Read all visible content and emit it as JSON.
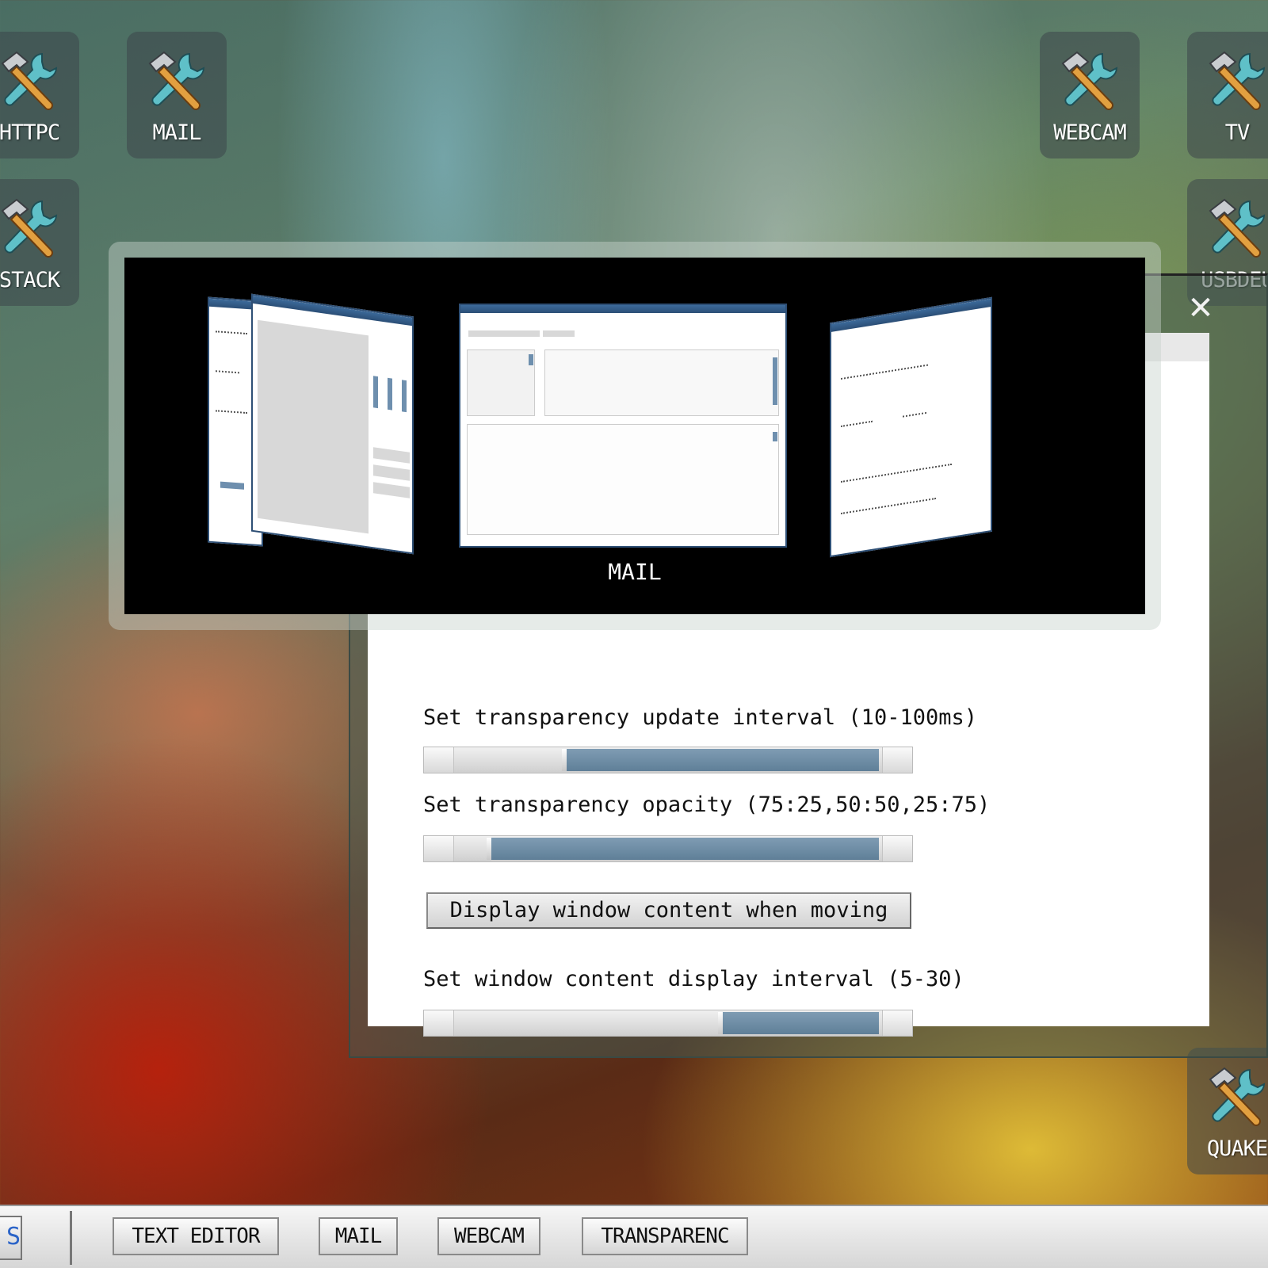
{
  "desktop": {
    "icons": [
      {
        "label": "HTTPC",
        "icon": "tools-icon"
      },
      {
        "label": "MAIL",
        "icon": "tools-icon"
      },
      {
        "label": "STACK",
        "icon": "tools-icon"
      },
      {
        "label": "WEBCAM",
        "icon": "tools-icon"
      },
      {
        "label": "TV",
        "icon": "tools-icon"
      },
      {
        "label": "USBDEU",
        "icon": "tools-icon"
      },
      {
        "label": "QUAKE",
        "icon": "tools-icon"
      }
    ]
  },
  "switcher": {
    "selected_title": "MAIL"
  },
  "settings": {
    "close_glyph": "✕",
    "update_interval_label": "Set transparency update interval (10-100ms)",
    "update_interval_fill": 0.74,
    "opacity_label": "Set transparency opacity (75:25,50:50,25:75)",
    "opacity_fill": 0.92,
    "move_content_button": "Display window content when moving",
    "display_interval_label": "Set window content display interval (5-30)",
    "display_interval_fill": 0.37
  },
  "taskbar": {
    "start_glyph": "S",
    "buttons": [
      "TEXT EDITOR",
      "MAIL",
      "WEBCAM",
      "TRANSPARENC"
    ]
  },
  "colors": {
    "accent": "#6e8fae",
    "titlebar": "#2b4e76"
  }
}
